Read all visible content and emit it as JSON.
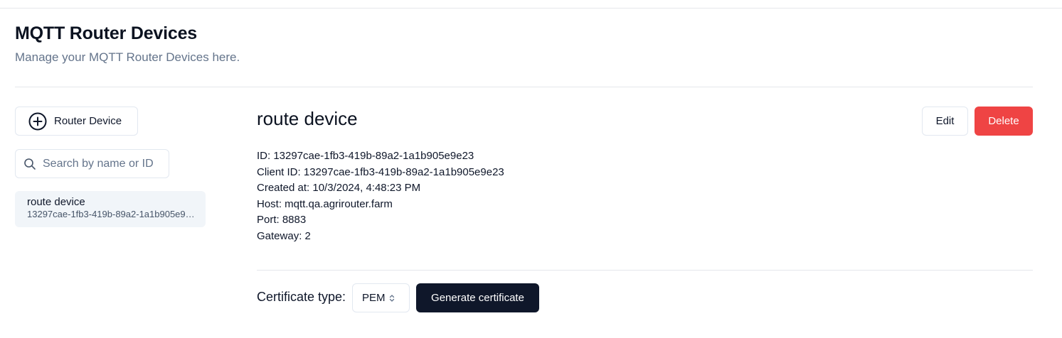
{
  "header": {
    "title": "MQTT Router Devices",
    "subtitle": "Manage your MQTT Router Devices here."
  },
  "sidebar": {
    "add_button_label": "Router Device",
    "add_button_icon": "plus-circle-icon",
    "search": {
      "placeholder": "Search by name or ID",
      "value": "",
      "icon": "search-icon"
    },
    "devices": [
      {
        "name": "route device",
        "id": "13297cae-1fb3-419b-89a2-1a1b905e9e23"
      }
    ]
  },
  "detail": {
    "title": "route device",
    "edit_label": "Edit",
    "delete_label": "Delete",
    "rows": [
      "ID: 13297cae-1fb3-419b-89a2-1a1b905e9e23",
      "Client ID: 13297cae-1fb3-419b-89a2-1a1b905e9e23",
      "Created at: 10/3/2024, 4:48:23 PM",
      "Host: mqtt.qa.agrirouter.farm",
      "Port: 8883",
      "Gateway: 2"
    ]
  },
  "certificate": {
    "label": "Certificate type:",
    "selected": "PEM",
    "select_icon": "chevron-up-down-icon",
    "generate_label": "Generate certificate"
  },
  "colors": {
    "danger": "#ef4444",
    "primary": "#0f172a",
    "selected_item_bg": "#f1f5f9",
    "border": "#e2e8f0"
  }
}
